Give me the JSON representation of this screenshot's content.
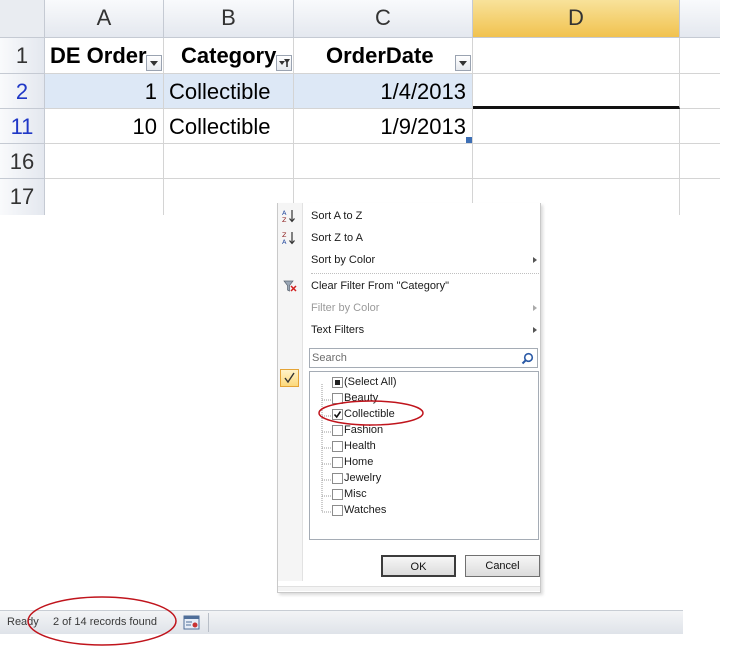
{
  "columns": [
    "A",
    "B",
    "C",
    "D"
  ],
  "rows": [
    {
      "num": "1",
      "cells": [
        "DE Order",
        "Category",
        "OrderDate",
        ""
      ]
    },
    {
      "num": "2",
      "cells": [
        "1",
        "Collectible",
        "1/4/2013",
        ""
      ]
    },
    {
      "num": "11",
      "cells": [
        "10",
        "Collectible",
        "1/9/2013",
        ""
      ]
    },
    {
      "num": "16",
      "cells": [
        "",
        "",
        "",
        ""
      ]
    },
    {
      "num": "17",
      "cells": [
        "",
        "",
        "",
        ""
      ]
    }
  ],
  "filter_menu": {
    "sort_az": "Sort A to Z",
    "sort_za": "Sort Z to A",
    "sort_color": "Sort by Color",
    "clear_filter": "Clear Filter From \"Category\"",
    "filter_color": "Filter by Color",
    "text_filters": "Text Filters",
    "search_placeholder": "Search",
    "items": [
      {
        "label": "(Select All)",
        "state": "partial"
      },
      {
        "label": "Beauty",
        "state": "unchecked"
      },
      {
        "label": "Collectible",
        "state": "checked"
      },
      {
        "label": "Fashion",
        "state": "unchecked"
      },
      {
        "label": "Health",
        "state": "unchecked"
      },
      {
        "label": "Home",
        "state": "unchecked"
      },
      {
        "label": "Jewelry",
        "state": "unchecked"
      },
      {
        "label": "Misc",
        "state": "unchecked"
      },
      {
        "label": "Watches",
        "state": "unchecked"
      }
    ],
    "ok_label": "OK",
    "cancel_label": "Cancel"
  },
  "status_bar": {
    "ready": "Ready",
    "records": "2 of 14 records found"
  },
  "colors": {
    "selected_col_header": "#f1c24f",
    "filtered_row_number": "#1f37c6",
    "annotation_circle": "#c0141c"
  }
}
